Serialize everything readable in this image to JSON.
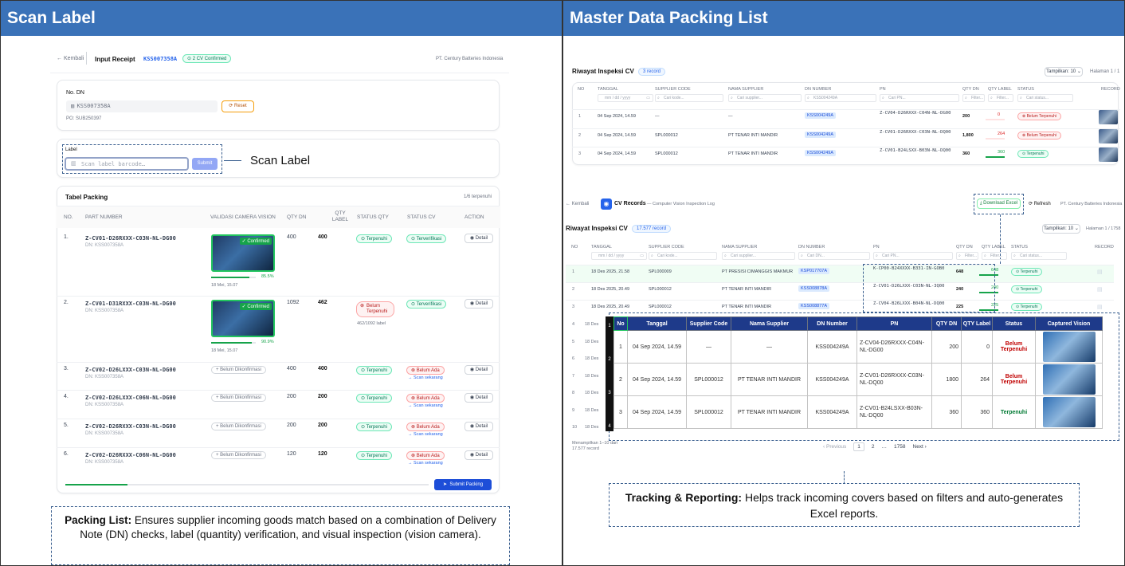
{
  "left": {
    "header": "Scan Label",
    "topbar": {
      "back": "Kembali",
      "title": "Input Receipt",
      "doc": "KSS007358A",
      "status": "2 CV Confirmed",
      "company": "PT. Century Batteries Indonesia"
    },
    "dn": {
      "label": "No. DN",
      "value": "KSS007358A",
      "reset": "Reset",
      "po": "PO: SUB250397"
    },
    "scan": {
      "label": "Label",
      "placeholder": "Scan label barcode…",
      "submit": "Submit",
      "annotation": "Scan Label"
    },
    "table": {
      "title": "Tabel Packing",
      "count": "1/6 terpenuhi",
      "headers": [
        "NO.",
        "PART NUMBER",
        "VALIDASI CAMERA VISION",
        "QTY DN",
        "QTY LABEL",
        "STATUS QTY",
        "STATUS CV",
        "ACTION"
      ],
      "rows": [
        {
          "no": "1.",
          "part": "Z-CV01-D26RXXX-C03N-NL-DG00",
          "dn": "DN: KSS007358A",
          "confirmed": "Confirmed",
          "pct": "85.5%",
          "pct_v": 85.5,
          "time": "18 Mei, 15.07",
          "qdn": "400",
          "qlbl": "400",
          "sqty": "Terpenuhi",
          "sqty_kind": "g",
          "scv": "Terverifikasi",
          "scv_kind": "g",
          "sub": "",
          "action": "Detail"
        },
        {
          "no": "2.",
          "part": "Z-CV01-D31RXXX-C03N-NL-DG00",
          "dn": "DN: KSS007358A",
          "confirmed": "Confirmed",
          "pct": "90.9%",
          "pct_v": 90.9,
          "time": "18 Mei, 15.07",
          "qdn": "1092",
          "qlbl": "462",
          "sqty": "Belum Terpenuhi",
          "sqty_kind": "r",
          "sqty_sub": "462/1092 label",
          "scv": "Terverifikasi",
          "scv_kind": "g",
          "sub": "",
          "action": "Detail"
        },
        {
          "no": "3.",
          "part": "Z-CV02-D26LXXX-C03N-NL-DG00",
          "dn": "DN: KSS007358A",
          "unconf": "Belum Dikonfirmasi",
          "qdn": "400",
          "qlbl": "400",
          "sqty": "Terpenuhi",
          "sqty_kind": "g",
          "scv": "Belum Ada",
          "scv_kind": "r",
          "sub": "Scan sekarang",
          "action": "Detail"
        },
        {
          "no": "4.",
          "part": "Z-CV02-D26LXXX-C06N-NL-DG00",
          "dn": "DN: KSS007358A",
          "unconf": "Belum Dikonfirmasi",
          "qdn": "200",
          "qlbl": "200",
          "sqty": "Terpenuhi",
          "sqty_kind": "g",
          "scv": "Belum Ada",
          "scv_kind": "r",
          "sub": "Scan sekarang",
          "action": "Detail"
        },
        {
          "no": "5.",
          "part": "Z-CV02-D26RXXX-C03N-NL-DG00",
          "dn": "DN: KSS007358A",
          "unconf": "Belum Dikonfirmasi",
          "qdn": "200",
          "qlbl": "200",
          "sqty": "Terpenuhi",
          "sqty_kind": "g",
          "scv": "Belum Ada",
          "scv_kind": "r",
          "sub": "Scan sekarang",
          "action": "Detail"
        },
        {
          "no": "6.",
          "part": "Z-CV02-D26RXXX-C06N-NL-DG00",
          "dn": "DN: KSS007358A",
          "unconf": "Belum Dikonfirmasi",
          "qdn": "120",
          "qlbl": "120",
          "sqty": "Terpenuhi",
          "sqty_kind": "g",
          "scv": "Belum Ada",
          "scv_kind": "r",
          "sub": "Scan sekarang",
          "action": "Detail"
        }
      ],
      "progress": 0.17,
      "submit": "Submit Packing"
    },
    "note": {
      "bold": "Packing List:",
      "text": " Ensures supplier incoming goods match based on a combination of Delivery Note (DN) checks, label (quantity) verification, and visual inspection (vision camera)."
    }
  },
  "right": {
    "header": "Master Data Packing List",
    "top": {
      "title": "Riwayat Inspeksi CV",
      "badge": "3 record",
      "show": "Tampilkan: 10",
      "page": "Halaman 1 / 1",
      "headers": [
        "NO",
        "TANGGAL",
        "SUPPLIER CODE",
        "NAMA SUPPLIER",
        "DN NUMBER",
        "PN",
        "QTY DN",
        "QTY LABEL",
        "STATUS",
        "RECORD"
      ],
      "filters": [
        "mm / dd / yyyy",
        "Cari kode...",
        "Cari supplier...",
        "KSS004249A",
        "Cari PN...",
        "Filter...",
        "Filter...",
        "Cari status..."
      ],
      "rows": [
        {
          "no": "1",
          "date": "04 Sep 2024, 14.59",
          "sc": "—",
          "ns": "—",
          "dn": "KSS004249A",
          "pn": "Z-CV04-D26RXXX-C04N-NL-DG00",
          "qdn": "200",
          "ql": "0",
          "st": "Belum Terpenuhi",
          "k": "r"
        },
        {
          "no": "2",
          "date": "04 Sep 2024, 14.59",
          "sc": "SPL000012",
          "ns": "PT TENAR INTI MANDIR",
          "dn": "KSS004249A",
          "pn": "Z-CV01-D26RXXX-C03N-NL-DQ00",
          "qdn": "1,800",
          "ql": "264",
          "st": "Belum Terpenuhi",
          "k": "r"
        },
        {
          "no": "3",
          "date": "04 Sep 2024, 14.59",
          "sc": "SPL000012",
          "ns": "PT TENAR INTI MANDIR",
          "dn": "KSS004249A",
          "pn": "Z-CV01-B24LSXX-B03N-NL-DQ00",
          "qdn": "360",
          "ql": "360",
          "st": "Terpenuhi",
          "k": "g"
        }
      ]
    },
    "bottom": {
      "back": "Kembali",
      "app": "CV Records",
      "app_sub": "— Computer Vision Inspection Log",
      "download": "Download Excel",
      "refresh": "Refresh",
      "company": "PT. Century Batteries Indonesia",
      "title": "Riwayat Inspeksi CV",
      "badge": "17.577 record",
      "show": "Tampilkan: 10",
      "page": "Halaman 1 / 1758",
      "headers": [
        "NO",
        "TANGGAL",
        "SUPPLIER CODE",
        "NAMA SUPPLIER",
        "DN NUMBER",
        "PN",
        "QTY DN",
        "QTY LABEL",
        "STATUS",
        "RECORD"
      ],
      "filters": [
        "mm / dd / yyyy",
        "Cari kode...",
        "Cari supplier...",
        "Cari DN...",
        "Cari PN...",
        "Filter...",
        "Filter...",
        "Cari status..."
      ],
      "rows": [
        {
          "no": "1",
          "date": "18 Des 2025, 21.58",
          "sc": "SPL000009",
          "ns": "PT PRESISI CIMANGGIS MAKMUR",
          "dn": "KSP017707A",
          "pn": "K-CP00-B24XXXX-B331-IN-GOB0",
          "qdn": "648",
          "ql": "648",
          "st": "Terpenuhi"
        },
        {
          "no": "2",
          "date": "18 Des 2025, 20.49",
          "sc": "SPL000012",
          "ns": "PT TENAR INTI MANDIR",
          "dn": "KSS008878A",
          "pn": "Z-CV01-D26LXXX-C03N-NL-3Q00",
          "qdn": "240",
          "ql": "240",
          "st": "Terpenuhi"
        },
        {
          "no": "3",
          "date": "18 Des 2025, 20.49",
          "sc": "SPL000012",
          "ns": "PT TENAR INTI MANDIR",
          "dn": "KSS008877A",
          "pn": "Z-CV04-B26LXXX-B04N-NL-DQ00",
          "qdn": "225",
          "ql": "225",
          "st": "Terpenuhi"
        }
      ],
      "more": [
        {
          "no": "4",
          "date": "18 Des"
        },
        {
          "no": "5",
          "date": "18 Des"
        },
        {
          "no": "6",
          "date": "18 Des"
        },
        {
          "no": "7",
          "date": "18 Des"
        },
        {
          "no": "8",
          "date": "18 Des"
        },
        {
          "no": "9",
          "date": "18 Des"
        },
        {
          "no": "10",
          "date": "18 Des"
        }
      ],
      "footer": "Menampilkan 1–10 dari 17.577 record",
      "pager": [
        "Previous",
        "1",
        "2",
        "…",
        "1758",
        "Next"
      ]
    },
    "excel": {
      "headers": [
        "No",
        "Tanggal",
        "Supplier Code",
        "Nama Supplier",
        "DN Number",
        "PN",
        "QTY DN",
        "QTY Label",
        "Status",
        "Captured Vision"
      ],
      "rows": [
        {
          "no": "1",
          "date": "04 Sep 2024, 14.59",
          "sc": "—",
          "ns": "—",
          "dn": "KSS004249A",
          "pn": "Z-CV04-D26RXXX-C04N-NL-DG00",
          "qdn": "200",
          "ql": "0",
          "st": "Belum Terpenuhi",
          "k": "r"
        },
        {
          "no": "2",
          "date": "04 Sep 2024, 14.59",
          "sc": "SPL000012",
          "ns": "PT TENAR INTI MANDIR",
          "dn": "KSS004249A",
          "pn": "Z-CV01-D26RXXX-C03N-NL-DQ00",
          "qdn": "1800",
          "ql": "264",
          "st": "Belum Terpenuhi",
          "k": "r"
        },
        {
          "no": "3",
          "date": "04 Sep 2024, 14.59",
          "sc": "SPL000012",
          "ns": "PT TENAR INTI MANDIR",
          "dn": "KSS004249A",
          "pn": "Z-CV01-B24LSXX-B03N-NL-DQ00",
          "qdn": "360",
          "ql": "360",
          "st": "Terpenuhi",
          "k": "g"
        }
      ],
      "row_numbers": [
        "1",
        "2",
        "3",
        "4"
      ]
    },
    "note": {
      "bold": "Tracking & Reporting:",
      "text": " Helps track incoming covers based on filters and auto-generates Excel reports."
    }
  },
  "colors": {
    "header_blue": "#3a72b8",
    "excel_header": "#1e3a8a",
    "green": "#16a34a",
    "red": "#dc2626",
    "primary": "#2563eb"
  }
}
